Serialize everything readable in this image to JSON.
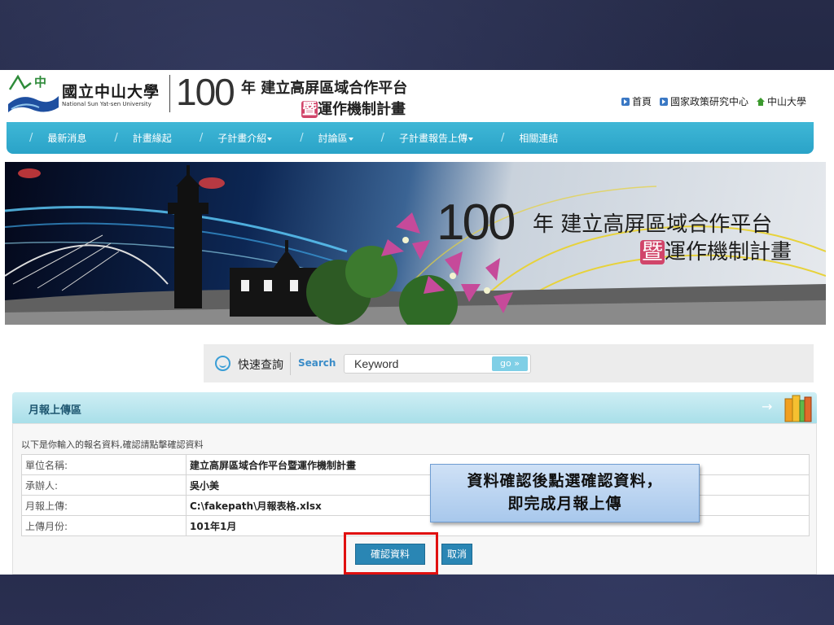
{
  "header": {
    "logo_cn": "國立中山大學",
    "logo_en": "National Sun Yat-sen University",
    "year": "100",
    "title_line1": "年 建立高屏區域合作平台",
    "title_line2_hl": "暨",
    "title_line2": "運作機制計畫",
    "top_links": [
      {
        "label": "首頁",
        "icon": "arrow-square-icon"
      },
      {
        "label": "國家政策研究中心",
        "icon": "arrow-square-icon"
      },
      {
        "label": "中山大學",
        "icon": "home-icon"
      }
    ]
  },
  "nav": {
    "items": [
      {
        "label": "最新消息",
        "dropdown": false
      },
      {
        "label": "計畫緣起",
        "dropdown": false
      },
      {
        "label": "子計畫介紹",
        "dropdown": true
      },
      {
        "label": "討論區",
        "dropdown": true
      },
      {
        "label": "子計畫報告上傳",
        "dropdown": true
      },
      {
        "label": "相關連結",
        "dropdown": false
      }
    ]
  },
  "banner": {
    "year": "100",
    "line1": "年 建立高屏區域合作平台",
    "line2_hl": "暨",
    "line2": "運作機制計畫"
  },
  "search": {
    "quick_label": "快速查詢",
    "label": "Search",
    "value": "Keyword",
    "go_label": "go »"
  },
  "section": {
    "title": "月報上傳區",
    "arrow": "→"
  },
  "form": {
    "intro": "以下是你輸入的報名資料,確認請點擊確認資料",
    "rows": [
      {
        "label": "單位名稱:",
        "value": "建立高屏區域合作平台暨運作機制計畫"
      },
      {
        "label": "承辦人:",
        "value": "吳小美"
      },
      {
        "label": "月報上傳:",
        "value": "C:\\fakepath\\月報表格.xlsx"
      },
      {
        "label": "上傳月份:",
        "value": "101年1月"
      }
    ],
    "confirm_label": "確認資料",
    "cancel_label": "取消"
  },
  "callout": {
    "line1": "資料確認後點選確認資料，",
    "line2": "即完成月報上傳"
  },
  "colors": {
    "nav": "#2aa3c8",
    "button": "#2a86b4",
    "highlight_box": "#e01010",
    "accent_pink": "#d1456a"
  }
}
